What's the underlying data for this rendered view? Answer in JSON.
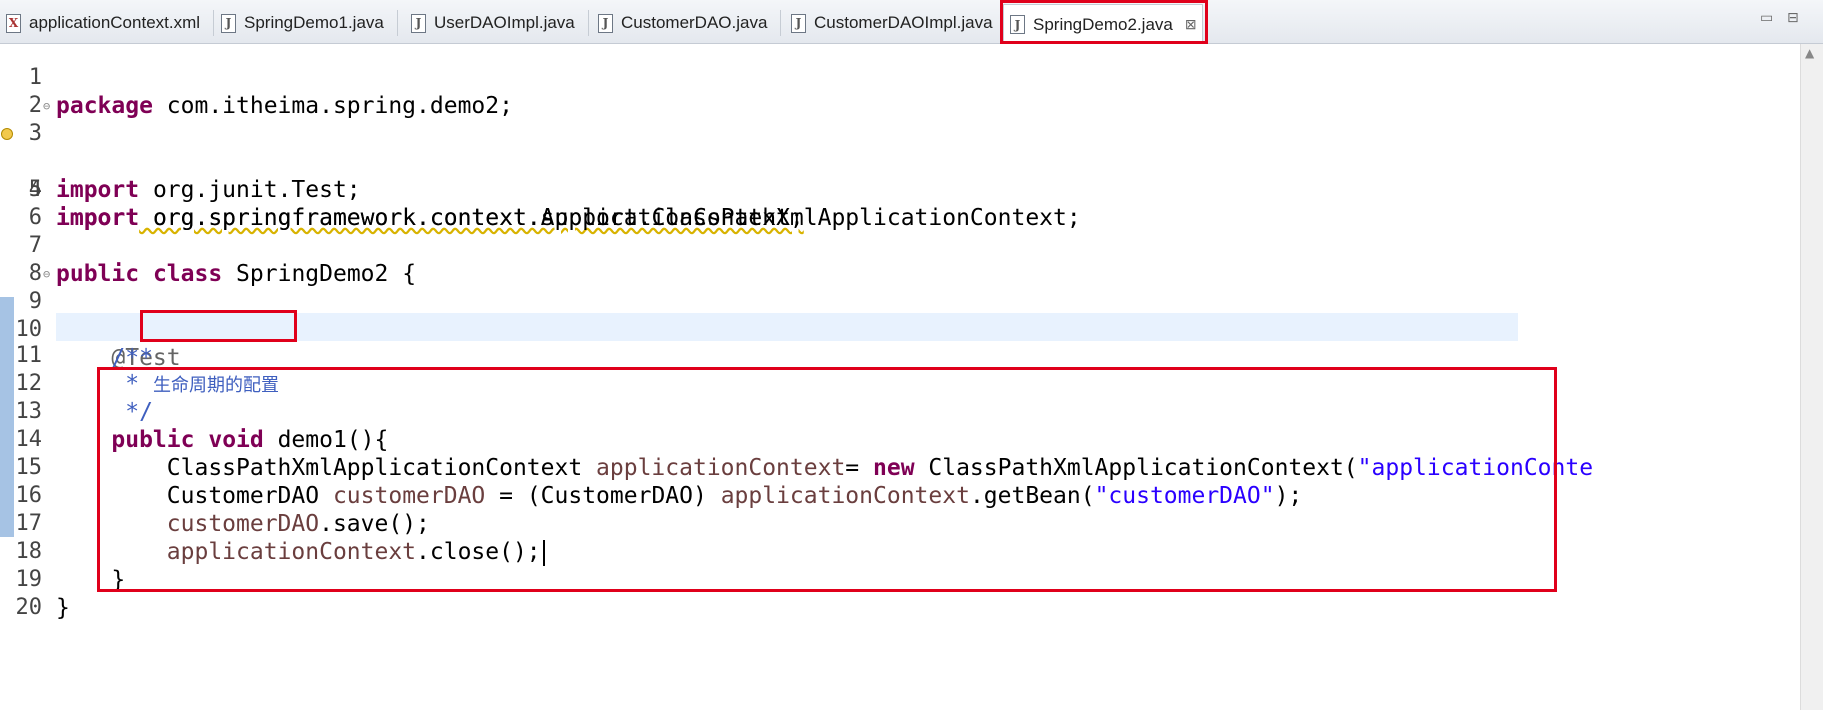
{
  "tabs": [
    {
      "label": "applicationContext.xml",
      "type": "xml",
      "active": false
    },
    {
      "label": "SpringDemo1.java",
      "type": "java",
      "active": false
    },
    {
      "label": "UserDAOImpl.java",
      "type": "java",
      "active": false
    },
    {
      "label": "CustomerDAO.java",
      "type": "java",
      "active": false
    },
    {
      "label": "CustomerDAOImpl.java",
      "type": "java",
      "active": false
    },
    {
      "label": "SpringDemo2.java",
      "type": "java",
      "active": true
    }
  ],
  "tab_icons": {
    "java": "J",
    "xml": "X",
    "close": "⊠"
  },
  "window_controls": {
    "minimize": "▭",
    "maximize": "⊟"
  },
  "line_numbers": [
    "1",
    "2",
    "3",
    "4",
    "5",
    "6",
    "7",
    "8",
    "9",
    "10",
    "11",
    "12",
    "13",
    "14",
    "15",
    "16",
    "17",
    "18",
    "19",
    "20"
  ],
  "code": {
    "l1_kw": "package",
    "l1_rest": " com.itheima.spring.demo2;",
    "l3_kw": "import",
    "l3_rest": " org.junit.Test;",
    "l4_kw": "import",
    "l4_rest": " org.springframework.context.ApplicationContext;",
    "l5_kw": "import",
    "l5_rest": " org.springframework.context.support.ClassPathXmlApplicationContext;",
    "l7_kw1": "public",
    "l7_kw2": "class",
    "l7_rest": " SpringDemo2 {",
    "l9_ann": "@Test",
    "l10_cm": "/**",
    "l11_cm": "* ",
    "l11_text": "生命周期的配置",
    "l12_cm": "*/",
    "l13_kw1": "public",
    "l13_kw2": "void",
    "l13_rest": " demo1(){",
    "l14_type": "ClassPathXmlApplicationContext ",
    "l14_var": "applicationContext",
    "l14_eq": "= ",
    "l14_kw": "new",
    "l14_rest": " ClassPathXmlApplicationContext(",
    "l14_str": "\"applicationConte",
    "l15_type": "CustomerDAO ",
    "l15_var": "customerDAO",
    "l15_mid": " = (CustomerDAO) ",
    "l15_var2": "applicationContext",
    "l15_call": ".getBean(",
    "l15_str": "\"customerDAO\"",
    "l15_end": ");",
    "l16_var": "customerDAO",
    "l16_rest": ".save();",
    "l17_var": "applicationContext",
    "l17_rest": ".close();",
    "l18": "}",
    "l19": "}"
  }
}
